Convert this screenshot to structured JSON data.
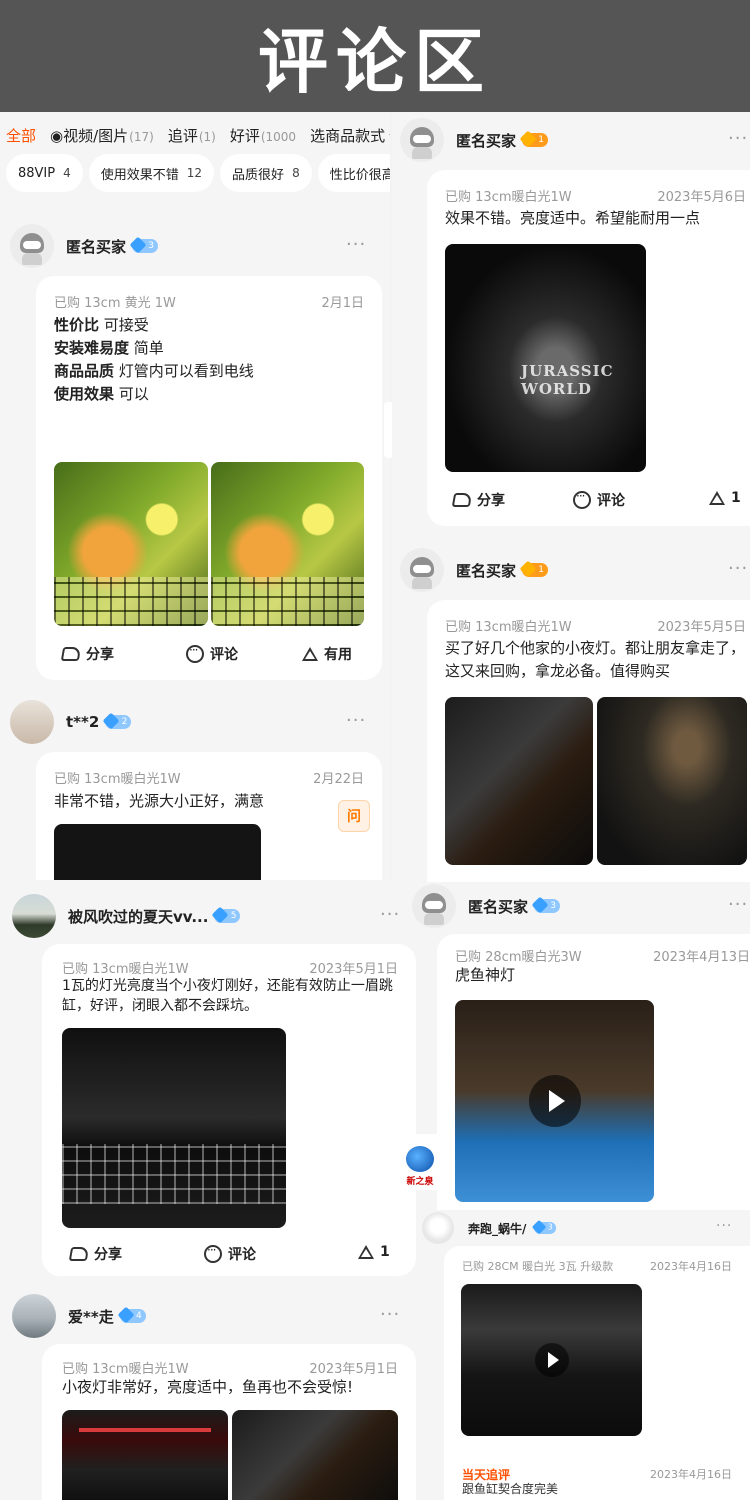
{
  "header": {
    "title": "评论区"
  },
  "tabs": [
    {
      "label": "全部",
      "count": ""
    },
    {
      "label": "◉视频/图片",
      "count": "(17)"
    },
    {
      "label": "追评",
      "count": "(1)"
    },
    {
      "label": "好评",
      "count": "(1000"
    },
    {
      "label": "选商品款式",
      "count": ""
    }
  ],
  "chips": [
    {
      "label": "88VIP",
      "count": "4"
    },
    {
      "label": "使用效果不错",
      "count": "12"
    },
    {
      "label": "品质很好",
      "count": "8"
    },
    {
      "label": "性比价很高",
      "count": ""
    }
  ],
  "reviews": [
    {
      "user": "匿名买家",
      "level": "3",
      "meta": "已购 13cm 黄光 1W",
      "date": "2月1日",
      "lines": [
        {
          "key": "性价比",
          "value": "可接受"
        },
        {
          "key": "安装难易度",
          "value": "简单"
        },
        {
          "key": "商品品质",
          "value": "灯管内可以看到电线"
        },
        {
          "key": "使用效果",
          "value": "可以"
        }
      ],
      "actions": {
        "share": "分享",
        "comment": "评论",
        "useful": "有用"
      }
    },
    {
      "user": "t**2",
      "level": "2",
      "meta": "已购 13cm暖白光1W",
      "date": "2月22日",
      "text": "非常不错，光源大小正好，满意",
      "ask": "问"
    },
    {
      "user": "被风吹过的夏天vv...",
      "level": "5",
      "meta": "已购 13cm暖白光1W",
      "date": "2023年5月1日",
      "text": "1瓦的灯光亮度当个小夜灯刚好，还能有效防止一眉跳缸，好评，闭眼入都不会踩坑。",
      "actions": {
        "share": "分享",
        "comment": "评论",
        "useful": "1"
      }
    },
    {
      "user": "爱**走",
      "level": "4",
      "meta": "已购 13cm暖白光1W",
      "date": "2023年5月1日",
      "text": "小夜灯非常好，亮度适中，鱼再也不会受惊!"
    },
    {
      "user": "匿名买家",
      "level": "1",
      "meta": "已购 13cm暖白光1W",
      "date": "2023年5月6日",
      "text": "效果不错。亮度适中。希望能耐用一点",
      "photo_watermark": "JURASSIC WORLD",
      "actions": {
        "share": "分享",
        "comment": "评论",
        "useful": "1"
      }
    },
    {
      "user": "匿名买家",
      "level": "1",
      "meta": "已购 13cm暖白光1W",
      "date": "2023年5月5日",
      "text": "买了好几个他家的小夜灯。都让朋友拿走了，这又来回购，拿龙必备。值得购买"
    },
    {
      "user": "匿名买家",
      "level": "3",
      "meta": "已购 28cm暖白光3W",
      "date": "2023年4月13日",
      "text": "虎鱼神灯"
    },
    {
      "user": "奔跑_蜗牛/",
      "level": "3",
      "meta": "已购 28CM 暖白光 3瓦 升级款",
      "date": "2023年4月16日",
      "followup_label": "当天追评",
      "followup_date": "2023年4月16日",
      "followup_text": "跟鱼缸契合度完美"
    }
  ],
  "logo_text": "新之泉",
  "colors": {
    "accent": "#ff5000",
    "header_bg": "#555555",
    "badge_blue": "#8fc7ff",
    "badge_orange": "#ff9b1a"
  }
}
